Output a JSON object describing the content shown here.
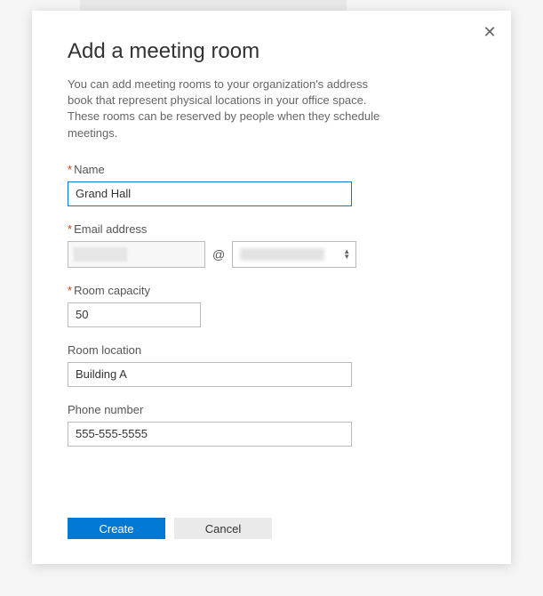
{
  "modal": {
    "title": "Add a meeting room",
    "description": "You can add meeting rooms to your organization's address book that represent physical locations in your office space. These rooms can be reserved by people when they schedule meetings."
  },
  "fields": {
    "name": {
      "label": "Name",
      "required": "*",
      "value": "Grand Hall"
    },
    "email": {
      "label": "Email address",
      "required": "*",
      "at": "@"
    },
    "capacity": {
      "label": "Room capacity",
      "required": "*",
      "value": "50"
    },
    "location": {
      "label": "Room location",
      "value": "Building A"
    },
    "phone": {
      "label": "Phone number",
      "value": "555-555-5555"
    }
  },
  "buttons": {
    "create": "Create",
    "cancel": "Cancel"
  },
  "icons": {
    "close": "✕"
  }
}
